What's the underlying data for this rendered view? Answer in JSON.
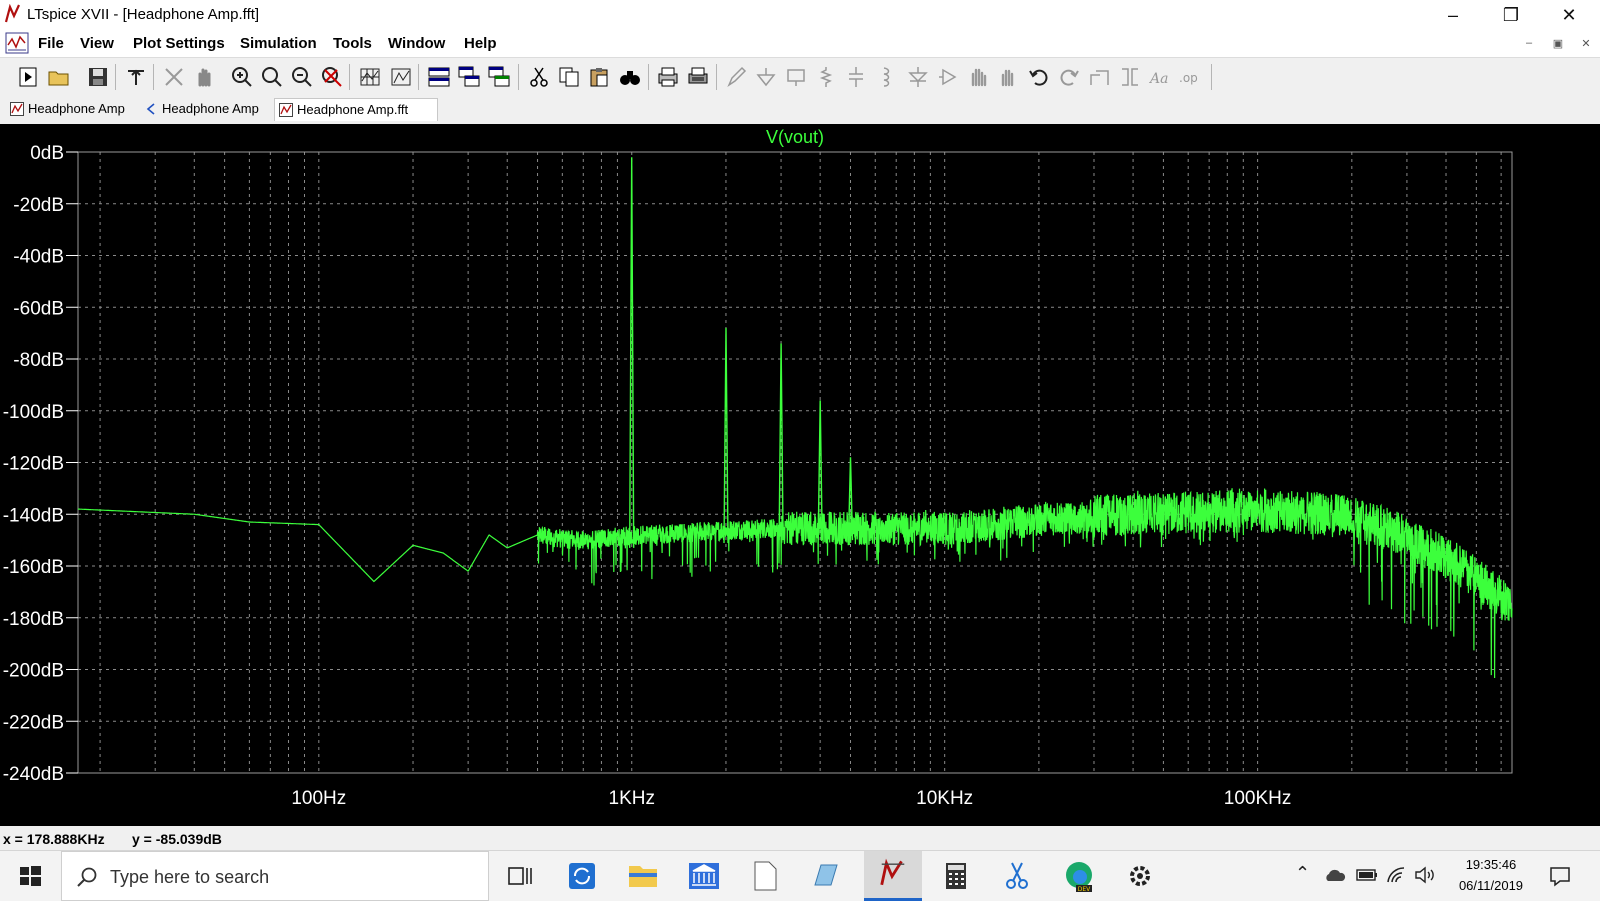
{
  "window": {
    "title": "LTspice XVII - [Headphone Amp.fft]",
    "minimize_icon": "minimize-icon",
    "restore_icon": "restore-icon",
    "close_icon": "close-icon"
  },
  "menu": {
    "items": [
      "File",
      "View",
      "Plot Settings",
      "Simulation",
      "Tools",
      "Window",
      "Help"
    ]
  },
  "tabs": [
    {
      "label": "Headphone Amp",
      "icon": "schematic-icon"
    },
    {
      "label": "Headphone Amp",
      "icon": "waveform-icon"
    },
    {
      "label": "Headphone Amp.fft",
      "icon": "fft-plot-icon",
      "active": true
    }
  ],
  "toolbar": {
    "icons": [
      "new-icon",
      "open-icon",
      "save-icon",
      "control-panel-icon",
      "autorange-icon",
      "pan-icon",
      "zoom-in-icon",
      "zoom-area-icon",
      "zoom-out-icon",
      "zoom-cancel-icon",
      "grid-icon",
      "axis-icon",
      "tile-horizontal-icon",
      "cascade-icon",
      "arrange-icon",
      "cut-icon",
      "copy-icon",
      "paste-icon",
      "find-icon",
      "print-icon",
      "print-setup-icon",
      "pencil-icon",
      "ground-icon",
      "label-net-icon",
      "resistor-icon",
      "capacitor-icon",
      "inductor-icon",
      "diode-icon",
      "component-icon",
      "move-icon",
      "drag-icon",
      "undo-icon",
      "redo-icon",
      "rotate-icon",
      "mirror-icon",
      "text-icon",
      "spice-directive-icon"
    ]
  },
  "chart_data": {
    "type": "line",
    "title": "V(vout)",
    "xscale": "log",
    "xlim": [
      17,
      650000
    ],
    "ylim": [
      -240,
      0
    ],
    "xticks": [
      "100Hz",
      "1KHz",
      "10KHz",
      "100KHz"
    ],
    "yticks": [
      "0dB",
      "-20dB",
      "-40dB",
      "-60dB",
      "-80dB",
      "-100dB",
      "-120dB",
      "-140dB",
      "-160dB",
      "-180dB",
      "-200dB",
      "-220dB",
      "-240dB"
    ],
    "grid": true,
    "series": [
      {
        "name": "V(vout)",
        "color": "#3cff3c",
        "floor": [
          [
            17,
            -138
          ],
          [
            40,
            -140
          ],
          [
            60,
            -143
          ],
          [
            100,
            -144
          ],
          [
            150,
            -166
          ],
          [
            200,
            -152
          ],
          [
            250,
            -155
          ],
          [
            300,
            -162
          ],
          [
            350,
            -148
          ],
          [
            400,
            -153
          ],
          [
            500,
            -148
          ],
          [
            700,
            -150
          ],
          [
            1000,
            -148
          ],
          [
            3000,
            -145
          ],
          [
            10000,
            -145
          ],
          [
            30000,
            -140
          ],
          [
            100000,
            -138
          ],
          [
            200000,
            -140
          ],
          [
            300000,
            -148
          ],
          [
            450000,
            -160
          ],
          [
            650000,
            -175
          ]
        ],
        "harmonics": [
          {
            "freq": 1000,
            "db": -2
          },
          {
            "freq": 2000,
            "db": -68
          },
          {
            "freq": 3000,
            "db": -74
          },
          {
            "freq": 4000,
            "db": -96
          },
          {
            "freq": 5000,
            "db": -118
          }
        ]
      }
    ]
  },
  "status": {
    "x": "x = 178.888KHz",
    "y": "y = -85.039dB"
  },
  "taskbar": {
    "search_placeholder": "Type here to search",
    "time": "19:35:46",
    "date": "06/11/2019"
  }
}
